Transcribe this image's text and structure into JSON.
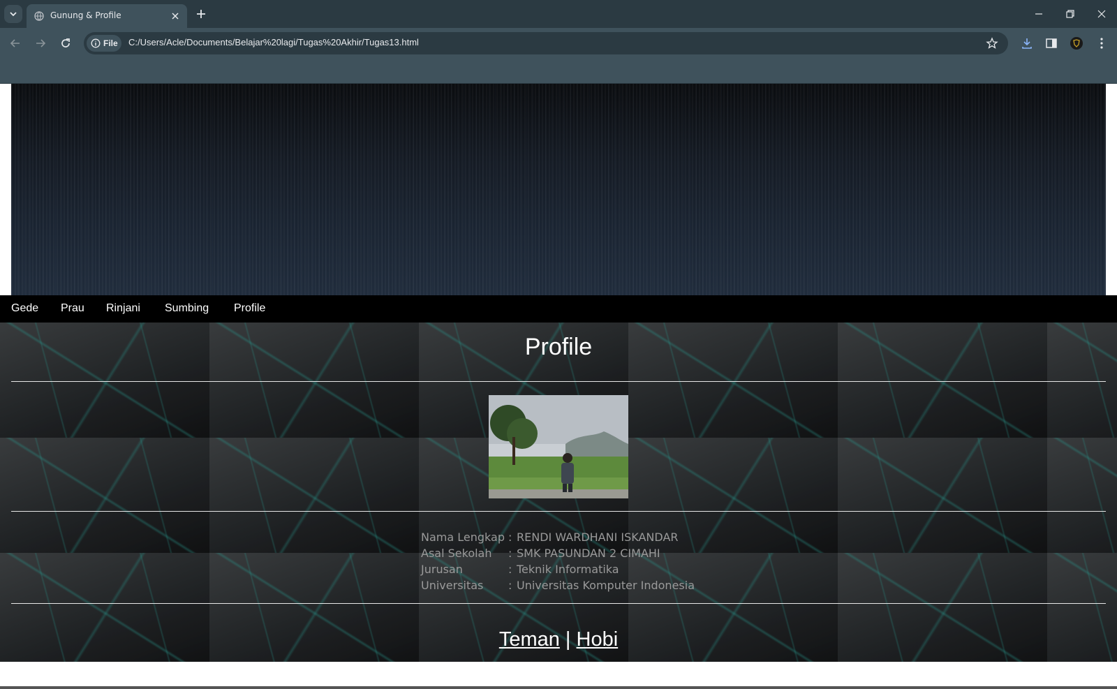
{
  "browser": {
    "tab_title": "Gunung & Profile",
    "omnibox_chip": "File",
    "url": "C:/Users/Acle/Documents/Belajar%20lagi/Tugas%20Akhir/Tugas13.html",
    "icons": [
      "tab-search-icon",
      "globe-icon",
      "close-icon",
      "plus-icon",
      "minimize-icon",
      "restore-icon",
      "window-close-icon",
      "back-icon",
      "forward-icon",
      "reload-icon",
      "info-icon",
      "star-icon",
      "download-icon",
      "side-panel-icon",
      "extension-icon",
      "menu-icon"
    ]
  },
  "nav": {
    "items": [
      {
        "label": "Gede"
      },
      {
        "label": "Prau"
      },
      {
        "label": "Rinjani"
      },
      {
        "label": "Sumbing"
      },
      {
        "label": "Profile"
      }
    ]
  },
  "profile": {
    "title": "Profile",
    "rows": [
      {
        "label": "Nama Lengkap",
        "sep": ":",
        "value": "RENDI WARDHANI ISKANDAR"
      },
      {
        "label": "Asal Sekolah",
        "sep": ":",
        "value": "SMK PASUNDAN 2 CIMAHI"
      },
      {
        "label": "Jurusan",
        "sep": ":",
        "value": "Teknik Informatika"
      },
      {
        "label": "Universitas",
        "sep": ":",
        "value": "Universitas Komputer Indonesia"
      }
    ],
    "links": {
      "teman": "Teman",
      "divider": "|",
      "hobi": "Hobi"
    }
  },
  "colors": {
    "chrome_dark": "#2b3a42",
    "chrome_light": "#3f525c",
    "navbar": "#000000",
    "text_light": "#e8eaed"
  }
}
